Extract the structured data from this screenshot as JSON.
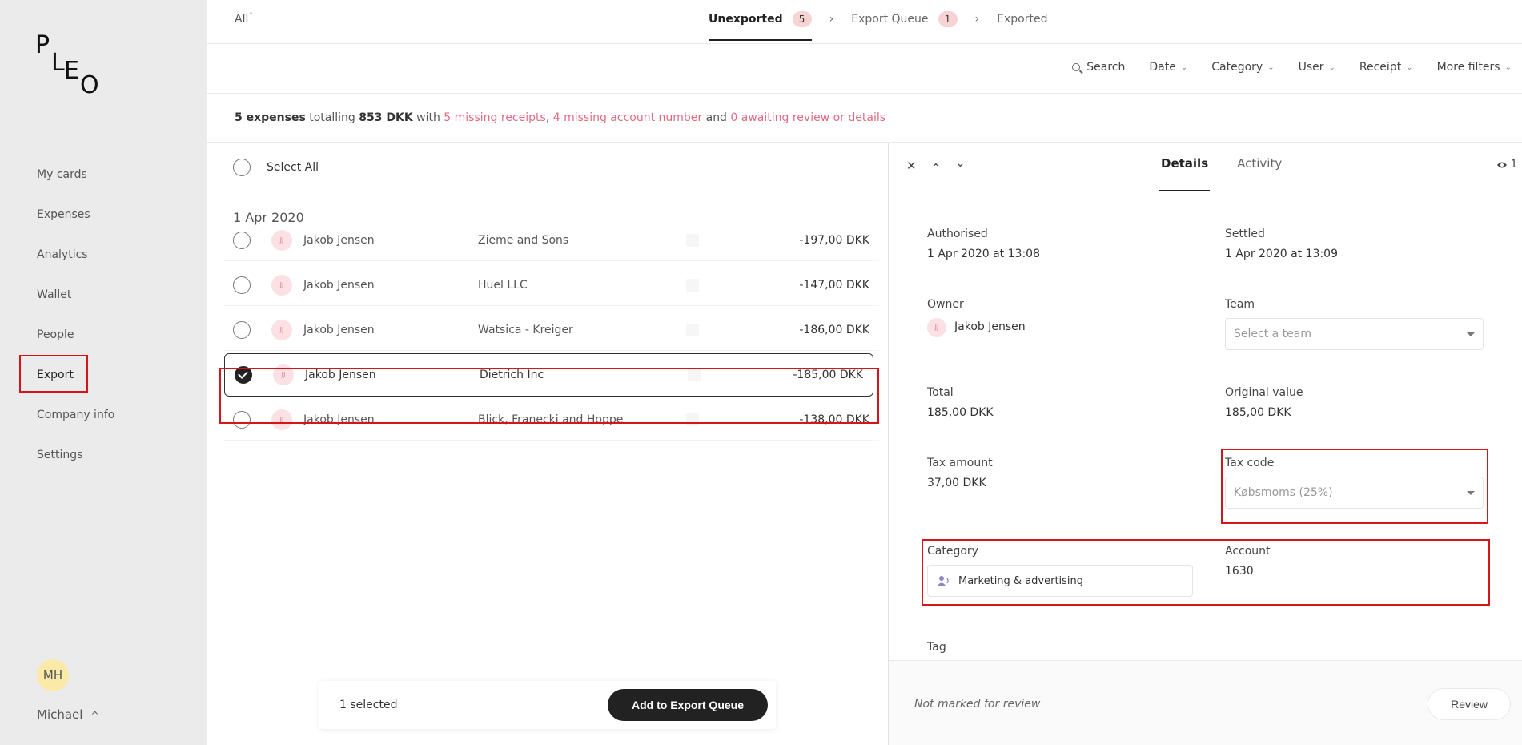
{
  "logo": {
    "letters": [
      "P",
      "L",
      "E",
      "O"
    ]
  },
  "sidebar": {
    "items": [
      {
        "label": "My cards"
      },
      {
        "label": "Expenses"
      },
      {
        "label": "Analytics"
      },
      {
        "label": "Wallet"
      },
      {
        "label": "People"
      },
      {
        "label": "Export"
      },
      {
        "label": "Company info"
      },
      {
        "label": "Settings"
      }
    ],
    "active": "Export",
    "user_initials": "MH",
    "user_name": "Michael",
    "user_caret": "^"
  },
  "topbar": {
    "all_label": "All",
    "steps": [
      {
        "label": "Unexported",
        "count": "5"
      },
      {
        "label": "Export Queue",
        "count": "1"
      },
      {
        "label": "Exported"
      }
    ],
    "separator": "›"
  },
  "filters": {
    "search": "Search",
    "date": "Date",
    "category": "Category",
    "user": "User",
    "receipt": "Receipt",
    "more": "More filters"
  },
  "summary": {
    "count": "5 expenses",
    "t1": "totalling",
    "total": "853 DKK",
    "t2": "with",
    "missing_receipts": "5 missing receipts",
    "comma": ",",
    "missing_account": "4 missing account number",
    "t3": "and",
    "awaiting": "0 awaiting review or details"
  },
  "list": {
    "select_all": "Select All",
    "date_header": "1 Apr 2020",
    "rows": [
      {
        "initials": "JJ",
        "name": "Jakob Jensen",
        "merchant": "Zieme and Sons",
        "amount": "-197,00 DKK"
      },
      {
        "initials": "JJ",
        "name": "Jakob Jensen",
        "merchant": "Huel LLC",
        "amount": "-147,00 DKK"
      },
      {
        "initials": "JJ",
        "name": "Jakob Jensen",
        "merchant": "Watsica - Kreiger",
        "amount": "-186,00 DKK"
      },
      {
        "initials": "JJ",
        "name": "Jakob Jensen",
        "merchant": "Dietrich Inc",
        "amount": "-185,00 DKK",
        "selected": true
      },
      {
        "initials": "JJ",
        "name": "Jakob Jensen",
        "merchant": "Blick, Franecki and Hoppe",
        "amount": "-138,00 DKK"
      }
    ]
  },
  "actionbar": {
    "selected_text": "1 selected",
    "button": "Add to Export Queue"
  },
  "panel": {
    "icons": {
      "close": "✕",
      "prev": "⌃",
      "next": "⌄"
    },
    "tabs": [
      {
        "label": "Details"
      },
      {
        "label": "Activity"
      }
    ],
    "viewers": "1",
    "authorised_label": "Authorised",
    "authorised_value": "1 Apr 2020 at 13:08",
    "settled_label": "Settled",
    "settled_value": "1 Apr 2020 at 13:09",
    "owner_label": "Owner",
    "owner_initials": "JJ",
    "owner_name": "Jakob Jensen",
    "team_label": "Team",
    "team_placeholder": "Select a team",
    "total_label": "Total",
    "total_value": "185,00 DKK",
    "original_label": "Original value",
    "original_value": "185,00 DKK",
    "tax_amount_label": "Tax amount",
    "tax_amount_value": "37,00 DKK",
    "tax_code_label": "Tax code",
    "tax_code_value": "Købsmoms (25%)",
    "category_label": "Category",
    "category_value": "Marketing & advertising",
    "account_label": "Account",
    "account_value": "1630",
    "tag_label": "Tag",
    "review_status": "Not marked for review",
    "review_button": "Review"
  },
  "colors": {
    "accent_pink": "#e06a80",
    "highlight_red": "#d7141a",
    "dark": "#222222"
  }
}
